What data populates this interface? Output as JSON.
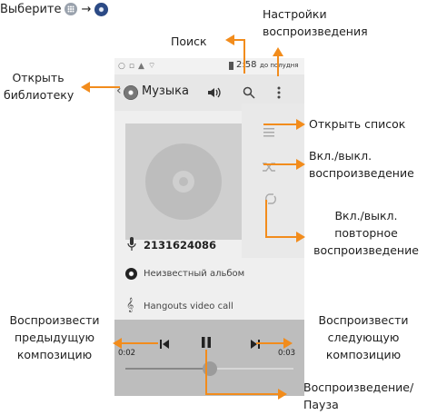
{
  "header": {
    "instruction": "Выберите",
    "arrow": "→"
  },
  "phone": {
    "status_time": "2:58",
    "status_extra": "до полудня",
    "app_title": "Музыка",
    "artist": "2131624086",
    "album": "Неизвестный альбом",
    "track": "Hangouts video call",
    "time_elapsed": "0:02",
    "time_total": "0:03",
    "progress_fraction": 0.5
  },
  "annotations": {
    "search": "Поиск",
    "settings_line1": "Настройки",
    "settings_line2": "воспроизведения",
    "library_line1": "Открыть",
    "library_line2": "библиотеку",
    "open_list": "Открыть список",
    "shuffle_line1": "Вкл./выкл.",
    "shuffle_line2": "воспроизведение",
    "repeat_line1": "Вкл./выкл.",
    "repeat_line2": "повторное",
    "repeat_line3": "воспроизведение",
    "prev_line1": "Воспроизвести",
    "prev_line2": "предыдущую",
    "prev_line3": "композицию",
    "next_line1": "Воспроизвести",
    "next_line2": "следующую",
    "next_line3": "композицию",
    "play_line1": "Воспроизведение/",
    "play_line2": "Пауза"
  },
  "colors": {
    "accent": "#f28c1c"
  }
}
